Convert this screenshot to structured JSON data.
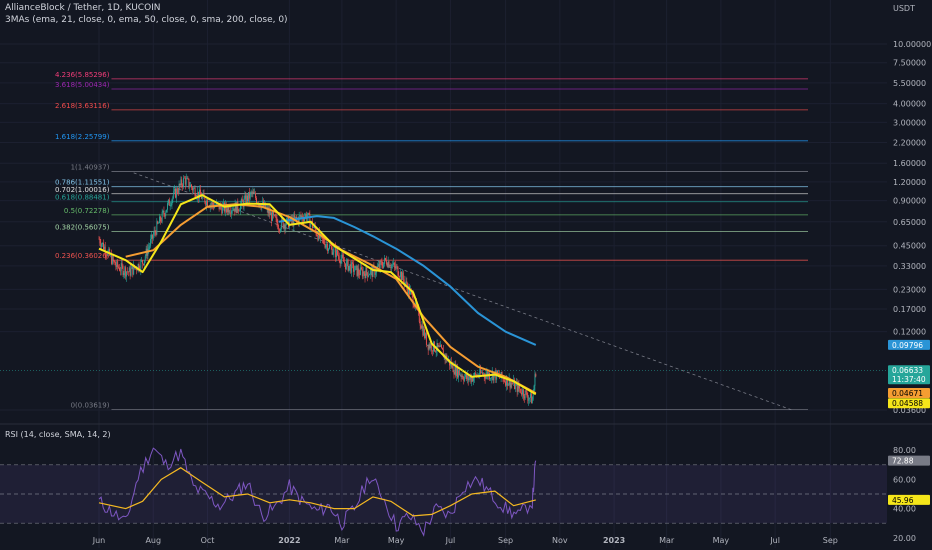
{
  "header": {
    "title": "AllianceBlock / Tether, 1D, KUCOIN",
    "indicator": "3MAs (ema, 21, close, 0, ema, 50, close, 0, sma, 200, close, 0)",
    "currency": "USDT"
  },
  "rsi_header": "RSI (14, close, SMA, 14, 2)",
  "price_axis": {
    "labels": [
      "10.00000",
      "7.50000",
      "5.50000",
      "4.00000",
      "3.00000",
      "2.20000",
      "1.60000",
      "1.20000",
      "0.90000",
      "0.65000",
      "0.45000",
      "0.33000",
      "0.23000",
      "0.17000",
      "0.12000",
      "0.03600"
    ],
    "values": [
      10,
      7.5,
      5.5,
      4,
      3,
      2.2,
      1.6,
      1.2,
      0.9,
      0.65,
      0.45,
      0.33,
      0.23,
      0.17,
      0.12,
      0.036
    ]
  },
  "rsi_axis": {
    "labels": [
      "80.00",
      "60.00",
      "40.00",
      "20.00"
    ],
    "values": [
      80,
      60,
      40,
      20
    ]
  },
  "time_axis": [
    "Jun",
    "Aug",
    "Oct",
    "2022",
    "Mar",
    "May",
    "Jul",
    "Sep",
    "Nov",
    "2023",
    "Mar",
    "May",
    "Jul",
    "Sep"
  ],
  "badges": {
    "sma200": "0.09796",
    "price": "0.06633",
    "countdown": "11:37:40",
    "ema50": "0.04671",
    "ema21": "0.04588",
    "rsi_value": "72.88",
    "rsi_ma": "45.96"
  },
  "colors": {
    "background": "#131722",
    "ema21": "#f5e61a",
    "ema50": "#f59d32",
    "sma200": "#2a94d6",
    "candle_up": "#26a69a",
    "candle_down": "#ef5350",
    "rsi_line": "#7e57c2",
    "rsi_ma": "#f5b922"
  },
  "chart_data": [
    {
      "type": "candlestick",
      "title": "AllianceBlock / Tether, 1D, KUCOIN",
      "y_scale": "log",
      "ylim": [
        0.036,
        10
      ],
      "x_range": [
        "2021-06",
        "2023-10"
      ],
      "close_path": {
        "dates": [
          "2021-06-01",
          "2021-06-20",
          "2021-07-05",
          "2021-07-20",
          "2021-08-05",
          "2021-08-20",
          "2021-09-05",
          "2021-09-20",
          "2021-10-05",
          "2021-10-20",
          "2021-11-05",
          "2021-11-20",
          "2021-12-05",
          "2021-12-20",
          "2022-01-05",
          "2022-01-20",
          "2022-02-05",
          "2022-02-20",
          "2022-03-05",
          "2022-03-20",
          "2022-04-05",
          "2022-04-20",
          "2022-05-05",
          "2022-05-20",
          "2022-06-05",
          "2022-06-20",
          "2022-07-05",
          "2022-07-20",
          "2022-08-05",
          "2022-08-20",
          "2022-09-05",
          "2022-09-20",
          "2022-10-01",
          "2022-10-05"
        ],
        "close": [
          0.5,
          0.33,
          0.3,
          0.35,
          0.6,
          0.9,
          1.25,
          1.0,
          0.85,
          0.8,
          0.82,
          1.0,
          0.8,
          0.62,
          0.66,
          0.72,
          0.5,
          0.42,
          0.34,
          0.3,
          0.3,
          0.36,
          0.3,
          0.2,
          0.1,
          0.09,
          0.068,
          0.058,
          0.063,
          0.062,
          0.056,
          0.048,
          0.042,
          0.066
        ]
      },
      "series": [
        {
          "name": "EMA 21",
          "dates": [
            "2021-06-01",
            "2021-07-01",
            "2021-07-20",
            "2021-08-10",
            "2021-09-01",
            "2021-09-25",
            "2021-10-20",
            "2021-11-15",
            "2021-12-10",
            "2022-01-01",
            "2022-01-25",
            "2022-02-20",
            "2022-03-15",
            "2022-04-05",
            "2022-04-25",
            "2022-05-20",
            "2022-06-10",
            "2022-07-01",
            "2022-07-25",
            "2022-08-20",
            "2022-09-10",
            "2022-10-05"
          ],
          "values": [
            0.43,
            0.36,
            0.3,
            0.48,
            0.85,
            0.98,
            0.82,
            0.86,
            0.85,
            0.62,
            0.65,
            0.45,
            0.37,
            0.31,
            0.3,
            0.22,
            0.1,
            0.075,
            0.06,
            0.062,
            0.056,
            0.04588
          ]
        },
        {
          "name": "EMA 50",
          "dates": [
            "2021-07-01",
            "2021-08-01",
            "2021-09-01",
            "2021-10-01",
            "2021-11-01",
            "2021-12-01",
            "2022-01-01",
            "2022-02-01",
            "2022-03-01",
            "2022-04-01",
            "2022-05-01",
            "2022-06-01",
            "2022-07-01",
            "2022-08-01",
            "2022-09-01",
            "2022-10-05"
          ],
          "values": [
            0.38,
            0.42,
            0.62,
            0.82,
            0.85,
            0.82,
            0.7,
            0.55,
            0.42,
            0.34,
            0.27,
            0.15,
            0.095,
            0.07,
            0.06,
            0.04671
          ]
        },
        {
          "name": "SMA 200",
          "dates": [
            "2021-12-20",
            "2022-01-10",
            "2022-02-01",
            "2022-02-20",
            "2022-03-15",
            "2022-04-05",
            "2022-05-01",
            "2022-06-01",
            "2022-07-01",
            "2022-08-01",
            "2022-09-01",
            "2022-10-05"
          ],
          "values": [
            0.65,
            0.68,
            0.71,
            0.69,
            0.6,
            0.52,
            0.43,
            0.33,
            0.24,
            0.16,
            0.12,
            0.09796
          ]
        }
      ],
      "fibonacci": [
        {
          "level": "4.236",
          "value": 5.85296,
          "color": "#f23d79"
        },
        {
          "level": "3.618",
          "value": 5.00434,
          "color": "#9c27b0"
        },
        {
          "level": "2.618",
          "value": 3.63116,
          "color": "#f44c4c"
        },
        {
          "level": "1.618",
          "value": 2.25799,
          "color": "#2196f3"
        },
        {
          "level": "1",
          "value": 1.40937,
          "color": "#787b86"
        },
        {
          "level": "0.786",
          "value": 1.11551,
          "color": "#81c3e8"
        },
        {
          "level": "0.702",
          "value": 1.00016,
          "color": "#e0e0e0"
        },
        {
          "level": "0.618",
          "value": 0.88481,
          "color": "#26a69a"
        },
        {
          "level": "0.5",
          "value": 0.72278,
          "color": "#66bb6a"
        },
        {
          "level": "0.382",
          "value": 0.56075,
          "color": "#a5d6a7"
        },
        {
          "level": "0.236",
          "value": 0.36026,
          "color": "#ef5350"
        },
        {
          "level": "0",
          "value": 0.03619,
          "color": "#787b86"
        }
      ],
      "fib_labels": [
        "4.236(5.85296)",
        "3.618(5.00434)",
        "2.618(3.63116)",
        "1.618(2.25799)",
        "1(1.40937)",
        "0.786(1.11551)",
        "0.702(1.00016)",
        "0.618(0.88481)",
        "0.5(0.72278)",
        "0.382(0.56075)",
        "0.236(0.36026)",
        "0(0.03619)"
      ],
      "trendline": {
        "from": {
          "date": "2021-07-10",
          "value": 1.38
        },
        "to": {
          "date": "2023-07-20",
          "value": 0.036
        },
        "style": "dashed"
      },
      "last_price": 0.06633
    },
    {
      "type": "line",
      "title": "RSI (14, close, SMA, 14, 2)",
      "ylim": [
        13,
        87
      ],
      "bands": {
        "upper": 70,
        "middle": 50,
        "lower": 30
      },
      "series": [
        {
          "name": "RSI",
          "dates": [
            "2021-06-01",
            "2021-06-15",
            "2021-07-01",
            "2021-07-15",
            "2021-08-01",
            "2021-08-15",
            "2021-09-01",
            "2021-09-15",
            "2021-10-01",
            "2021-10-15",
            "2021-11-01",
            "2021-11-15",
            "2021-12-01",
            "2021-12-15",
            "2022-01-01",
            "2022-01-15",
            "2022-02-01",
            "2022-02-15",
            "2022-03-01",
            "2022-03-15",
            "2022-04-01",
            "2022-04-15",
            "2022-05-01",
            "2022-05-15",
            "2022-06-01",
            "2022-06-15",
            "2022-07-01",
            "2022-07-15",
            "2022-08-01",
            "2022-08-15",
            "2022-09-01",
            "2022-09-15",
            "2022-10-01",
            "2022-10-05"
          ],
          "values": [
            45,
            38,
            30,
            62,
            82,
            70,
            78,
            55,
            48,
            42,
            50,
            58,
            35,
            40,
            55,
            45,
            38,
            42,
            30,
            40,
            62,
            50,
            28,
            35,
            25,
            40,
            35,
            55,
            60,
            50,
            40,
            35,
            45,
            72.88
          ]
        },
        {
          "name": "RSI MA",
          "dates": [
            "2021-06-01",
            "2021-07-01",
            "2021-07-20",
            "2021-08-10",
            "2021-09-01",
            "2021-09-25",
            "2021-10-20",
            "2021-11-15",
            "2021-12-10",
            "2022-01-01",
            "2022-01-25",
            "2022-02-20",
            "2022-03-15",
            "2022-04-05",
            "2022-04-25",
            "2022-05-20",
            "2022-06-10",
            "2022-07-01",
            "2022-07-25",
            "2022-08-20",
            "2022-09-10",
            "2022-10-05"
          ],
          "values": [
            44,
            40,
            45,
            60,
            68,
            58,
            48,
            50,
            44,
            46,
            44,
            40,
            40,
            48,
            45,
            35,
            36,
            42,
            50,
            52,
            42,
            45.96
          ]
        }
      ]
    }
  ]
}
